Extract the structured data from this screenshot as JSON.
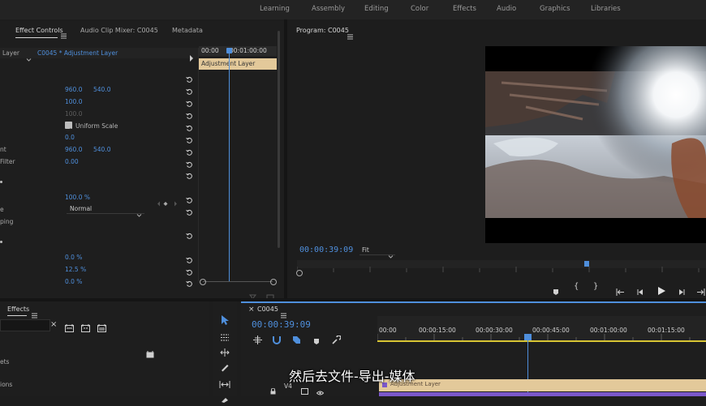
{
  "workspace_tabs": [
    "Learning",
    "Assembly",
    "Editing",
    "Color",
    "Effects",
    "Audio",
    "Graphics",
    "Libraries"
  ],
  "effect_controls": {
    "tabs": [
      "Effect Controls",
      "Audio Clip Mixer: C0045",
      "Metadata"
    ],
    "source_label": "Layer",
    "clip_label": "C0045 * Adjustment Layer",
    "ruler_times": [
      "00:00",
      "00:01:00:00"
    ],
    "clip_bar_label": "Adjustment Layer",
    "rows": {
      "position_x": "960.0",
      "position_y": "540.0",
      "scale": "100.0",
      "scale_width": "100.0",
      "uniform_scale": "Uniform Scale",
      "rotation": "0.0",
      "anchor_label": "nt",
      "anchor_x": "960.0",
      "anchor_y": "540.0",
      "flicker_label": "Filter",
      "flicker_value": "0.00",
      "opacity": "100.0 %",
      "blend_label": "e",
      "blend_mode": "Normal",
      "mask_label": "ping",
      "tr_0": "0.0 %",
      "tr_1": "12.5 %",
      "tr_2": "0.0 %"
    }
  },
  "program": {
    "title": "Program: C0045",
    "timecode": "00:00:39:09",
    "fit": "Fit"
  },
  "effects_panel": {
    "title": "Effects",
    "left_label_1": "ets",
    "left_label_2": "ions"
  },
  "timeline": {
    "sequence": "C0045",
    "timecode": "00:00:39:09",
    "ruler": [
      "00:00",
      "00:00:15:00",
      "00:00:30:00",
      "00:00:45:00",
      "00:01:00:00",
      "00:01:15:00"
    ],
    "track_label": "V4",
    "clip_label": "Adjustment Layer"
  },
  "subtitle": "然后去文件-导出-媒体",
  "colors": {
    "accent": "#4f8fdc",
    "clip": "#e3c99a",
    "yellow_line": "#d8c534"
  }
}
